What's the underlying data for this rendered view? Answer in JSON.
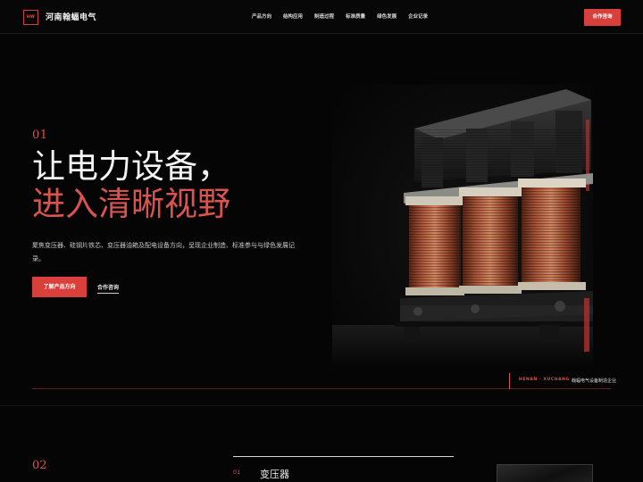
{
  "header": {
    "logo_mark": "HW",
    "logo_text": "河南翰蝠电气",
    "nav": [
      "产品方向",
      "结构应用",
      "制造过程",
      "标准质量",
      "绿色发展",
      "企业记录"
    ],
    "cta_label": "合作咨询"
  },
  "hero": {
    "number": "01",
    "title_line1": "让电力设备，",
    "title_line2": "进入清晰视野",
    "description": "聚焦变压器、硅钢片铁芯、变压器油箱及配电设备方向，呈现企业制造、标准参与与绿色发展记录。",
    "primary_button": "了解产品方向",
    "secondary_link": "合作咨询",
    "caption_location": "HENAN · XUCHANG",
    "caption_text": "翰蝠电气设备制造企业"
  },
  "section2": {
    "number": "02",
    "card_number": "01",
    "card_title": "变压器"
  },
  "colors": {
    "accent": "#d9403c",
    "background": "#050505",
    "copper": "#b2563a"
  },
  "icons": {
    "hero_image": "transformer-photo"
  }
}
